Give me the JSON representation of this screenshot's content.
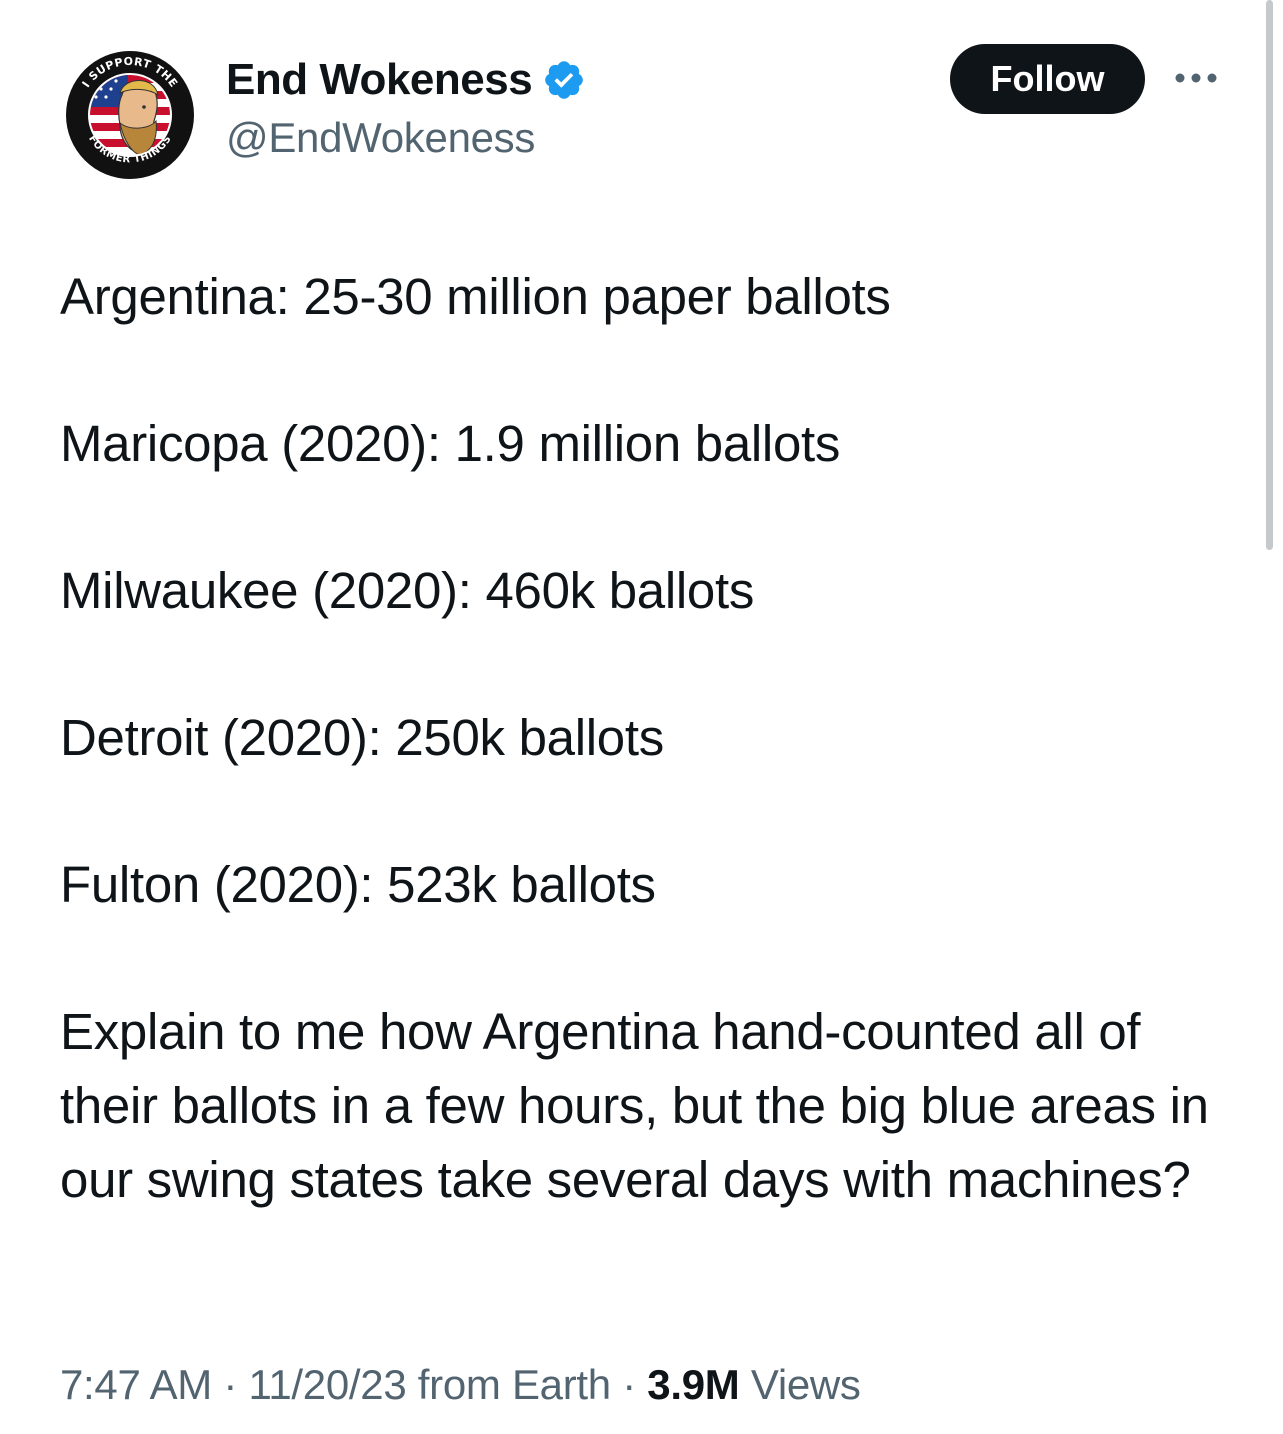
{
  "author": {
    "display_name": "End Wokeness",
    "handle": "@EndWokeness",
    "verified": true,
    "verified_badge_color": "#1d9bf0",
    "avatar_icon": "avatar-badge-icon",
    "avatar_text_top": "I SUPPORT THE",
    "avatar_text_bottom": "FORMER THINGS"
  },
  "actions": {
    "follow_label": "Follow",
    "more_icon": "more-horizontal-icon"
  },
  "tweet": {
    "paragraphs": [
      "Argentina: 25-30 million paper ballots",
      "Maricopa (2020): 1.9 million ballots",
      "Milwaukee (2020): 460k ballots",
      "Detroit (2020): 250k ballots",
      "Fulton (2020): 523k ballots",
      "Explain to me how Argentina hand-counted all of their ballots in a few hours, but the big blue areas in our swing states take several days with machines?"
    ]
  },
  "meta": {
    "time": "7:47 AM",
    "separator": " · ",
    "date": "11/20/23",
    "source": "from Earth",
    "views_count": "3.9M",
    "views_label": "Views"
  },
  "colors": {
    "text_primary": "#0f1419",
    "text_secondary": "#536471",
    "follow_bg": "#0f1419",
    "follow_text": "#ffffff"
  }
}
